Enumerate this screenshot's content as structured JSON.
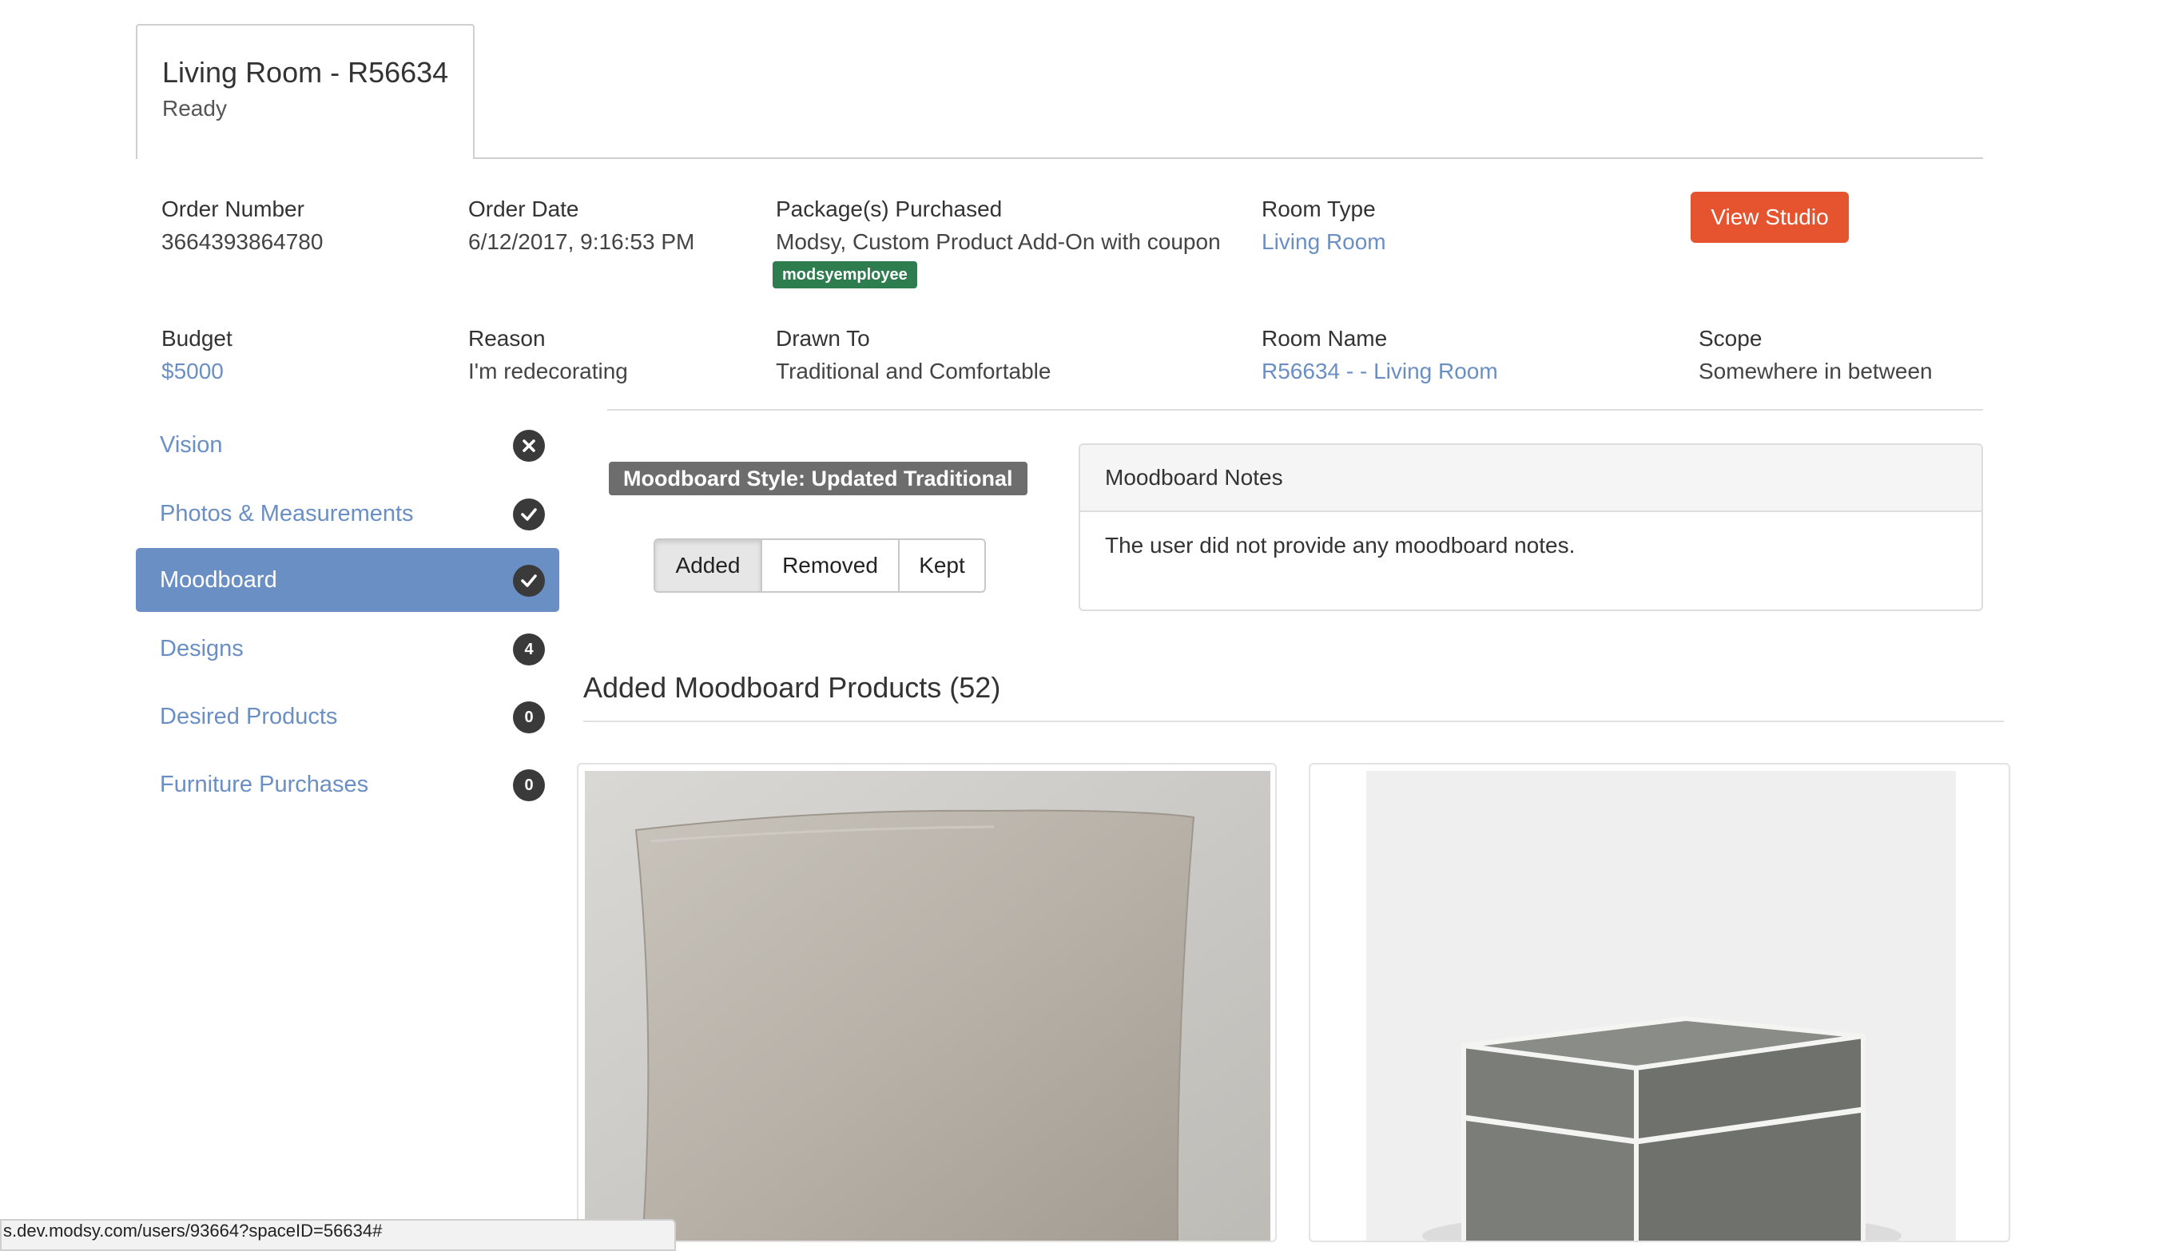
{
  "tab": {
    "title": "Living Room - R56634",
    "status": "Ready"
  },
  "info": {
    "order_number": {
      "label": "Order Number",
      "value": "3664393864780"
    },
    "order_date": {
      "label": "Order Date",
      "value": "6/12/2017, 9:16:53 PM"
    },
    "packages": {
      "label": "Package(s) Purchased",
      "value": "Modsy, Custom Product Add-On with coupon",
      "coupon": "modsyemployee"
    },
    "room_type": {
      "label": "Room Type",
      "value": "Living Room"
    },
    "view_studio_label": "View Studio",
    "budget": {
      "label": "Budget",
      "value": "$5000"
    },
    "reason": {
      "label": "Reason",
      "value": "I'm redecorating"
    },
    "drawn_to": {
      "label": "Drawn To",
      "value": "Traditional and Comfortable"
    },
    "room_name": {
      "label": "Room Name",
      "value": "R56634 - - Living Room"
    },
    "scope": {
      "label": "Scope",
      "value": "Somewhere in between"
    }
  },
  "sidebar": {
    "items": [
      {
        "label": "Vision",
        "badge_icon": "x-circle-icon"
      },
      {
        "label": "Photos & Measurements",
        "badge_icon": "check-circle-icon"
      },
      {
        "label": "Moodboard",
        "badge_icon": "check-circle-icon",
        "active": true
      },
      {
        "label": "Designs",
        "count": "4"
      },
      {
        "label": "Desired Products",
        "count": "0"
      },
      {
        "label": "Furniture Purchases",
        "count": "0"
      }
    ]
  },
  "moodboard": {
    "style_badge": "Moodboard Style: Updated Traditional",
    "filters": [
      "Added",
      "Removed",
      "Kept"
    ],
    "active_filter": "Added",
    "notes_title": "Moodboard Notes",
    "notes_body": "The user did not provide any moodboard notes.",
    "products_title": "Added Moodboard Products (52)"
  },
  "status_bar": {
    "url": "s.dev.modsy.com/users/93664?spaceID=56634#"
  },
  "colors": {
    "link": "#6a8fc4",
    "active_sidebar": "#6a8fc4",
    "view_studio": "#e5532f",
    "coupon_badge": "#2e7d4f",
    "style_badge": "#6d6d6d"
  }
}
